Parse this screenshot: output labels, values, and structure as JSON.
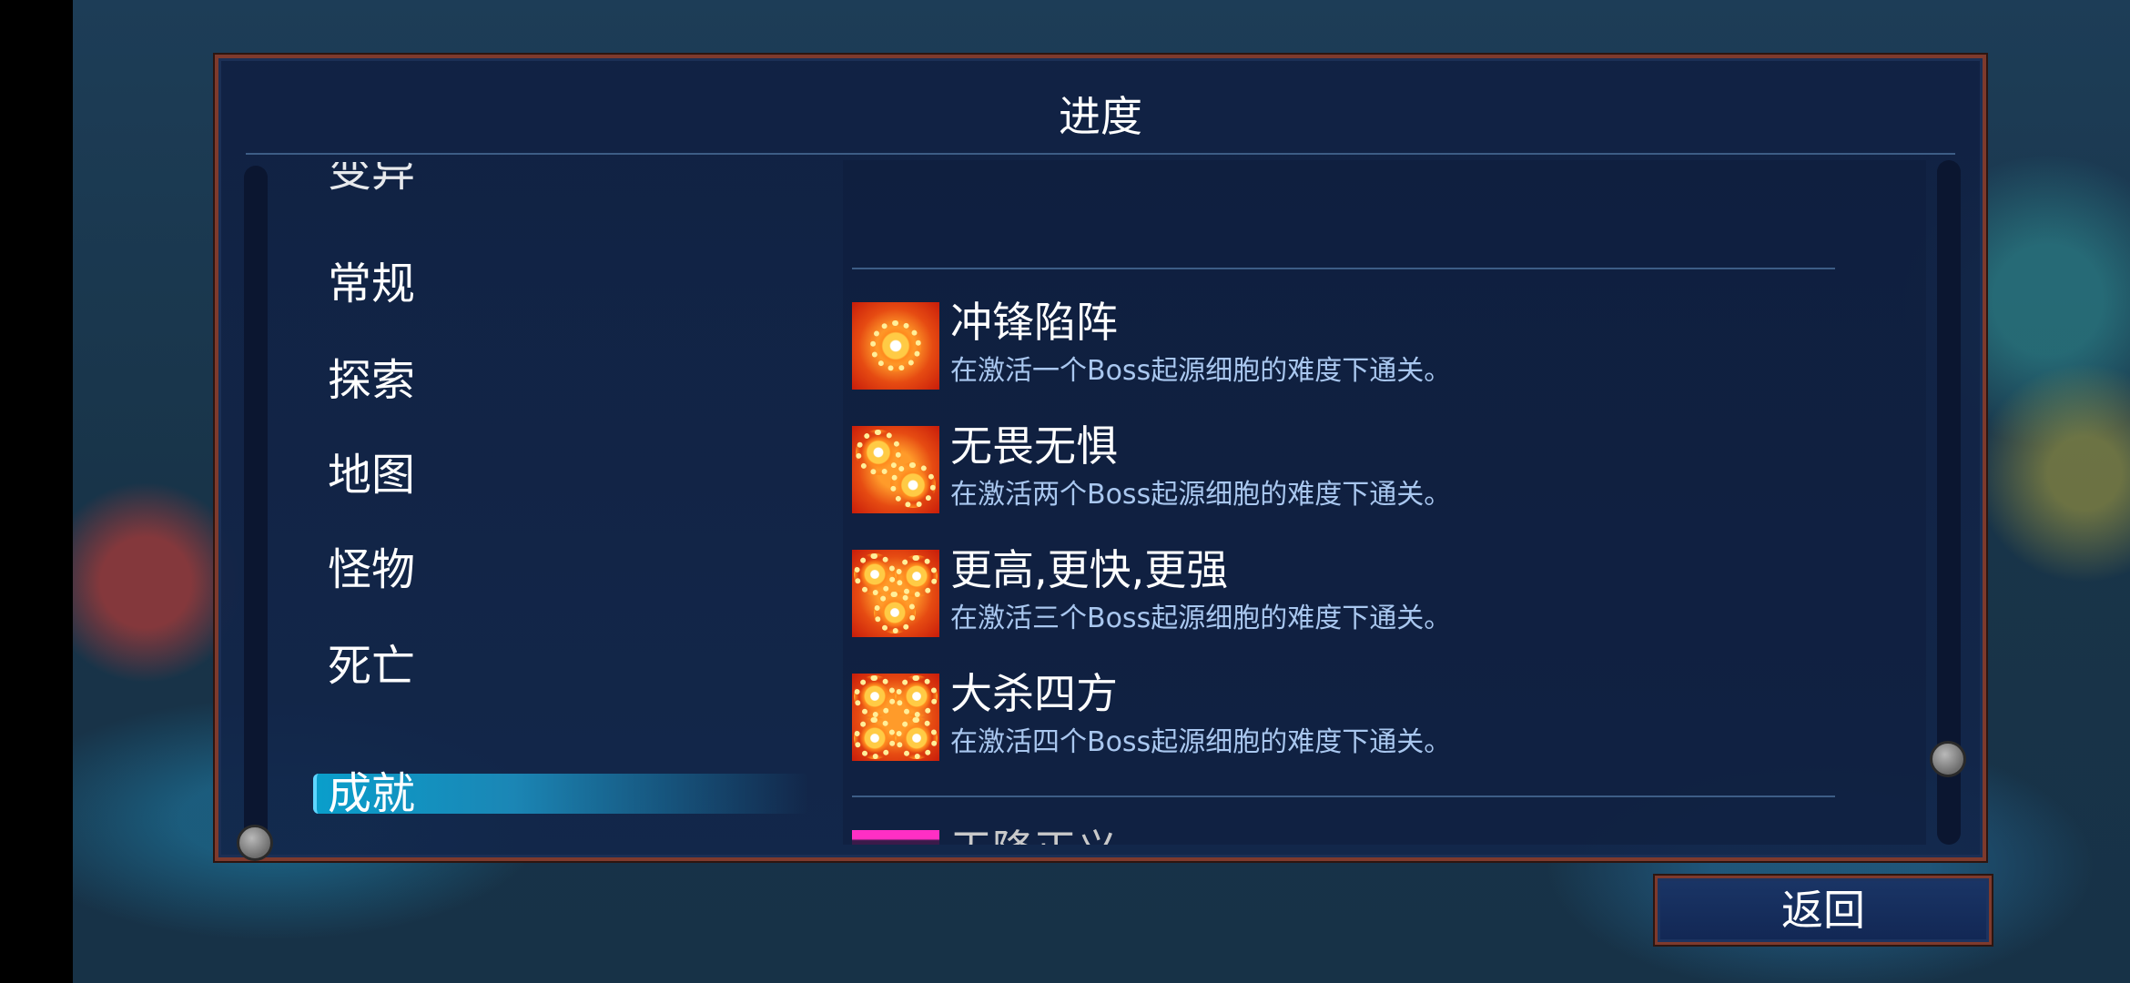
{
  "panel": {
    "title": "进度"
  },
  "categories": {
    "partial_top": "变异",
    "items": [
      "常规",
      "探索",
      "地图",
      "怪物",
      "死亡"
    ],
    "selected": "成就"
  },
  "achievements": [
    {
      "name": "冲锋陷阵",
      "description": "在激活一个Boss起源细胞的难度下通关。",
      "icon": "boss-cell-1-icon"
    },
    {
      "name": "无畏无惧",
      "description": "在激活两个Boss起源细胞的难度下通关。",
      "icon": "boss-cell-2-icon"
    },
    {
      "name": "更高,更快,更强",
      "description": "在激活三个Boss起源细胞的难度下通关。",
      "icon": "boss-cell-3-icon"
    },
    {
      "name": "大杀四方",
      "description": "在激活四个Boss起源细胞的难度下通关。",
      "icon": "boss-cell-4-icon"
    }
  ],
  "locked_achievement": {
    "name": "天降正义",
    "icon": "skull-icon"
  },
  "footer": {
    "back_label": "返回"
  },
  "colors": {
    "frame_border": "#7e3a2d",
    "selected_highlight": "#0a9ecb",
    "description_text": "#a9c7ef"
  }
}
